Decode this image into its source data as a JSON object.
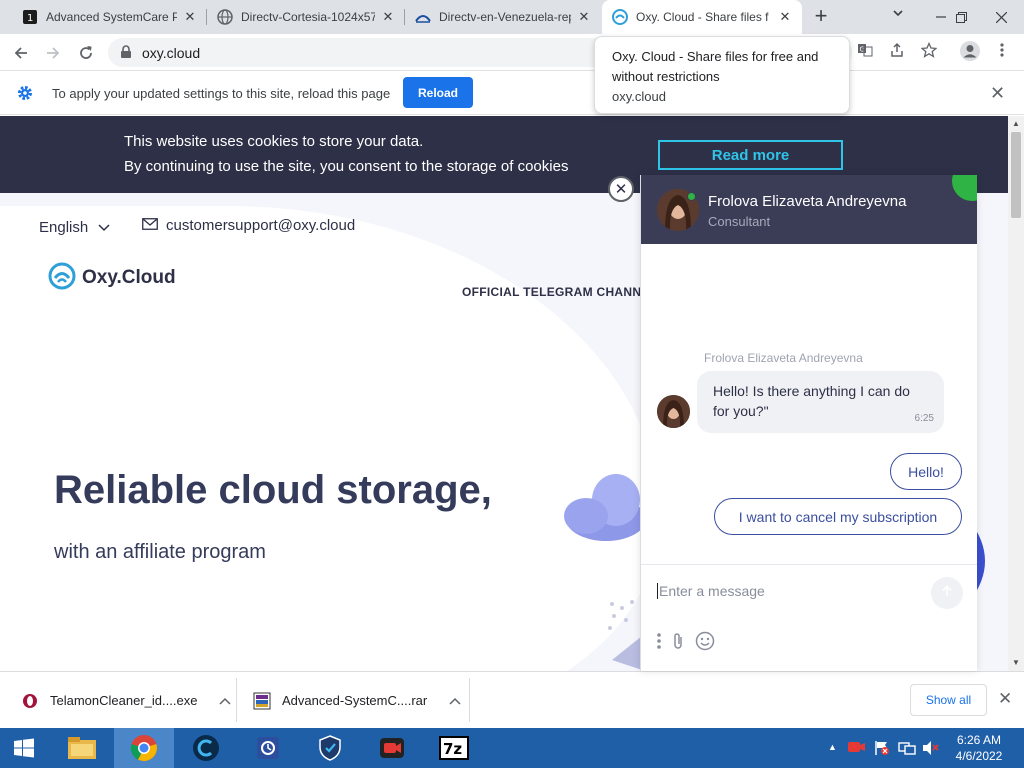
{
  "browser": {
    "tabs": [
      {
        "title": "Advanced SystemCare Pr",
        "icon": "iobit-icon",
        "active": false
      },
      {
        "title": "Directv-Cortesia-1024x57",
        "icon": "globe-icon",
        "active": false
      },
      {
        "title": "Directv-en-Venezuela-rep",
        "icon": "directv-icon",
        "active": false
      },
      {
        "title": "Oxy. Cloud - Share files f",
        "icon": "oxy-cloud-icon",
        "active": true
      }
    ],
    "address": "oxy.cloud",
    "tooltip": {
      "title": "Oxy. Cloud - Share files for free and without restrictions",
      "url": "oxy.cloud"
    },
    "infobar": {
      "message": "To apply your updated settings to this site, reload this page",
      "button": "Reload"
    }
  },
  "page": {
    "cookie": {
      "line1": "This website uses cookies to store your data.",
      "line2": "By continuing to use the site, you consent to the storage of cookies",
      "button": "Read more"
    },
    "language": "English",
    "support_email": "customersupport@oxy.cloud",
    "logo_text": "Oxy.Cloud",
    "telegram_link": "OFFICIAL TELEGRAM CHANN",
    "hero_title": "Reliable cloud storage,",
    "hero_subtitle": "with an affiliate program"
  },
  "chat": {
    "close_glyph": "✕",
    "agent_name": "Frolova Elizaveta Andreyevna",
    "agent_role": "Consultant",
    "message_sender": "Frolova Elizaveta Andreyevna",
    "message_text": "Hello! Is there anything I can do for you?\"",
    "message_time": "6:25",
    "quick_replies": [
      "Hello!",
      "I want to cancel my subscription"
    ],
    "input_placeholder": "Enter a message"
  },
  "downloads": {
    "items": [
      {
        "name": "TelamonCleaner_id....exe"
      },
      {
        "name": "Advanced-SystemC....rar"
      }
    ],
    "show_all": "Show all"
  },
  "taskbar": {
    "time": "6:26 AM",
    "date": "4/6/2022"
  },
  "colors": {
    "cookie_bg": "#2d3047",
    "accent_cyan": "#2fc4e8",
    "chat_header": "#3b3d56",
    "online_green": "#2fb344",
    "reload_blue": "#1a73e8",
    "taskbar_blue": "#1f5fa8"
  }
}
